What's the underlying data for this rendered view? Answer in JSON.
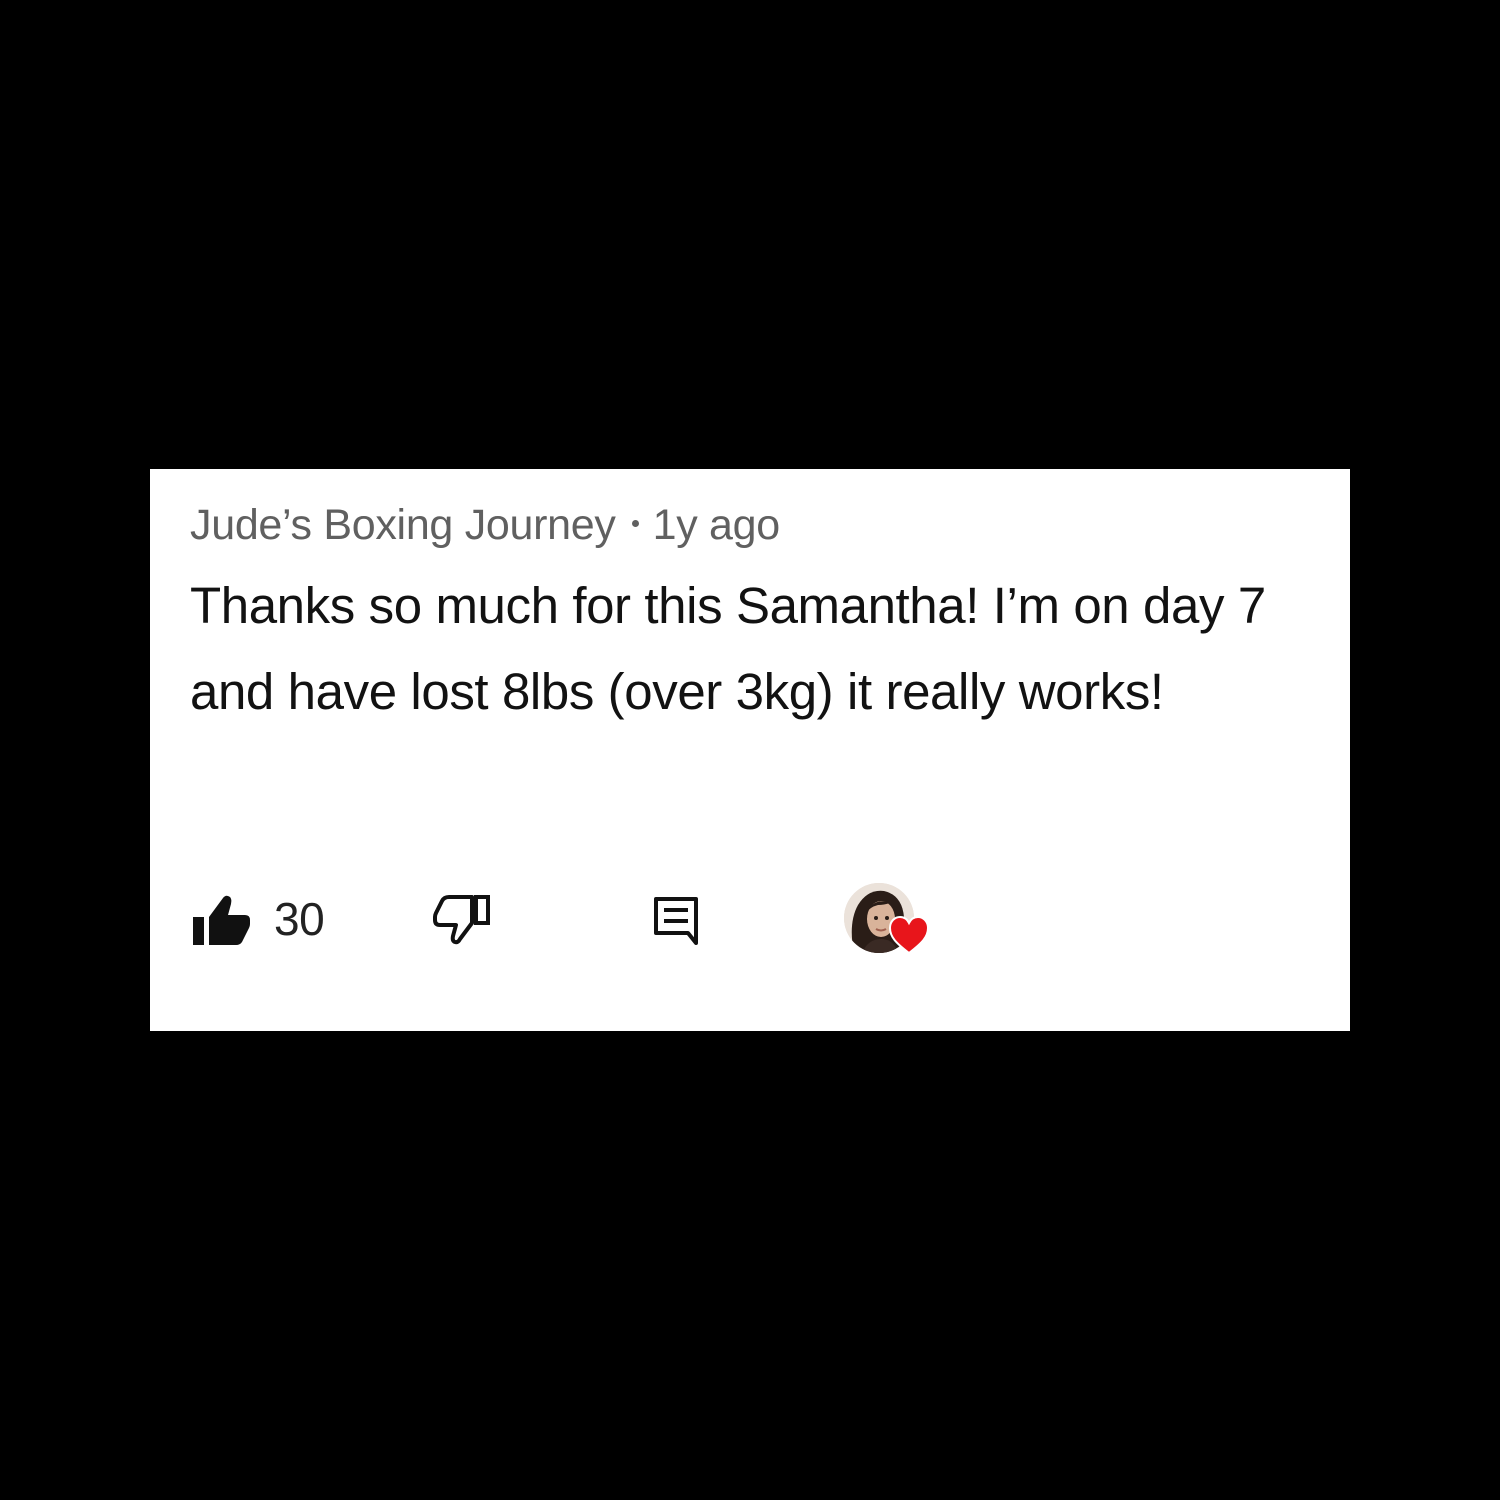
{
  "comment": {
    "author": "Jude’s Boxing Journey",
    "age": "1y ago",
    "text": "Thanks so much for this Samantha! I’m on day 7 and have lost 8lbs (over 3kg) it really works!"
  },
  "actions": {
    "like_count": "30",
    "like_icon": "thumbs-up-icon",
    "dislike_icon": "thumbs-down-icon",
    "reply_icon": "reply-comment-icon",
    "creator_heart_icon": "heart-icon"
  },
  "colors": {
    "background": "#000000",
    "card": "#ffffff",
    "meta_text": "#606060",
    "body_text": "#121212",
    "heart": "#e8151b"
  }
}
